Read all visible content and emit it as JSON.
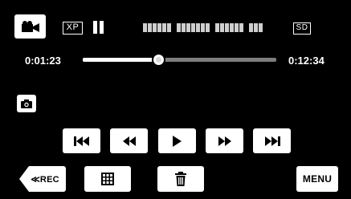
{
  "header": {
    "mode_icon": "video-camera-icon",
    "quality": "XP",
    "status_icon": "pause-icon",
    "media": "SD"
  },
  "progress": {
    "elapsed": "0:01:23",
    "total": "0:12:34",
    "fraction": 0.39
  },
  "buttons": {
    "snapshot_icon": "camera-icon",
    "skip_back_icon": "skip-previous-icon",
    "rewind_icon": "rewind-icon",
    "play_icon": "play-icon",
    "fast_forward_icon": "fast-forward-icon",
    "skip_forward_icon": "skip-next-icon",
    "rec_label": "≪REC",
    "index_icon": "grid-index-icon",
    "delete_icon": "trash-icon",
    "menu_label": "MENU"
  }
}
